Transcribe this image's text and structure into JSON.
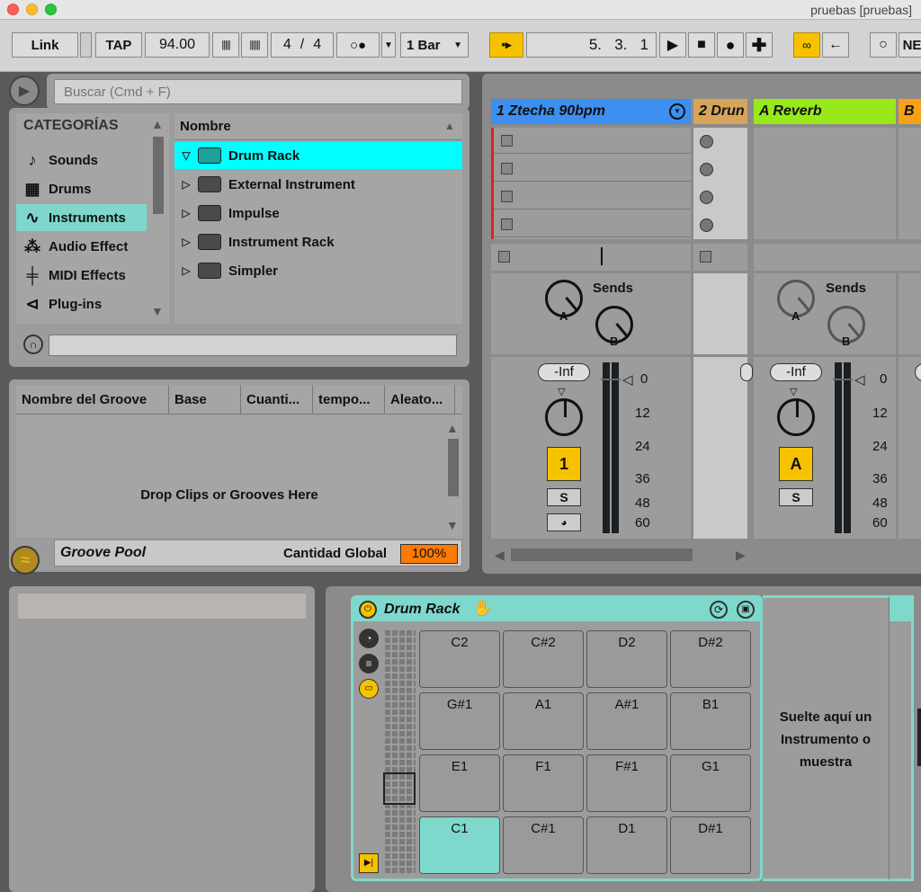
{
  "window": {
    "title": "pruebas  [pruebas]"
  },
  "transport": {
    "link": "Link",
    "tap": "TAP",
    "tempo": "94.00",
    "signature_num": "4",
    "signature_sep": "/",
    "signature_den": "4",
    "quantization": "1 Bar",
    "position": "5.   3.   1",
    "nb": "NE"
  },
  "browser": {
    "search_placeholder": "Buscar (Cmd + F)",
    "categories_header": "CATEGORÍAS",
    "categories": [
      {
        "label": "Sounds",
        "icon": "note-icon"
      },
      {
        "label": "Drums",
        "icon": "grid-icon"
      },
      {
        "label": "Instruments",
        "icon": "wave-icon"
      },
      {
        "label": "Audio Effect",
        "icon": "audio-effect-icon"
      },
      {
        "label": "MIDI Effects",
        "icon": "midi-effects-icon"
      },
      {
        "label": "Plug-ins",
        "icon": "plug-icon"
      }
    ],
    "list_header": "Nombre",
    "items": [
      {
        "label": "Drum Rack",
        "expanded": true
      },
      {
        "label": "External Instrument"
      },
      {
        "label": "Impulse"
      },
      {
        "label": "Instrument Rack"
      },
      {
        "label": "Simpler"
      }
    ]
  },
  "groove": {
    "columns": [
      "Nombre del Groove",
      "Base",
      "Cuanti...",
      "tempo...",
      "Aleato..."
    ],
    "drop_text": "Drop Clips or Grooves Here",
    "pool_label": "Groove Pool",
    "global_label": "Cantidad Global",
    "global_value": "100%"
  },
  "tracks": [
    {
      "name": "1 Ztecha 90bpm",
      "color": "#3d8ff0",
      "number": "1"
    },
    {
      "name": "2 Drun",
      "color": "#d6a45a"
    },
    {
      "name": "A Reverb",
      "color": "#98e81a",
      "number": "A"
    },
    {
      "name": "B",
      "color": "#f5a21a"
    }
  ],
  "mixer": {
    "sends": "Sends",
    "send_a": "A",
    "send_b": "B",
    "volume": "-Inf",
    "solo": "S",
    "meter_ticks": [
      "0",
      "12",
      "24",
      "36",
      "48",
      "60"
    ]
  },
  "drum_rack": {
    "title": "Drum Rack",
    "pads": [
      [
        "C2",
        "C#2",
        "D2",
        "D#2"
      ],
      [
        "G#1",
        "A1",
        "A#1",
        "B1"
      ],
      [
        "E1",
        "F1",
        "F#1",
        "G1"
      ],
      [
        "C1",
        "C#1",
        "D1",
        "D#1"
      ]
    ],
    "drop_text": "Suelte aquí un Instrumento o muestra"
  },
  "colors": {
    "accent": "#f6c200",
    "cyan": "#00ffff",
    "rack": "#7fd8cc",
    "orange": "#ff7a00"
  }
}
